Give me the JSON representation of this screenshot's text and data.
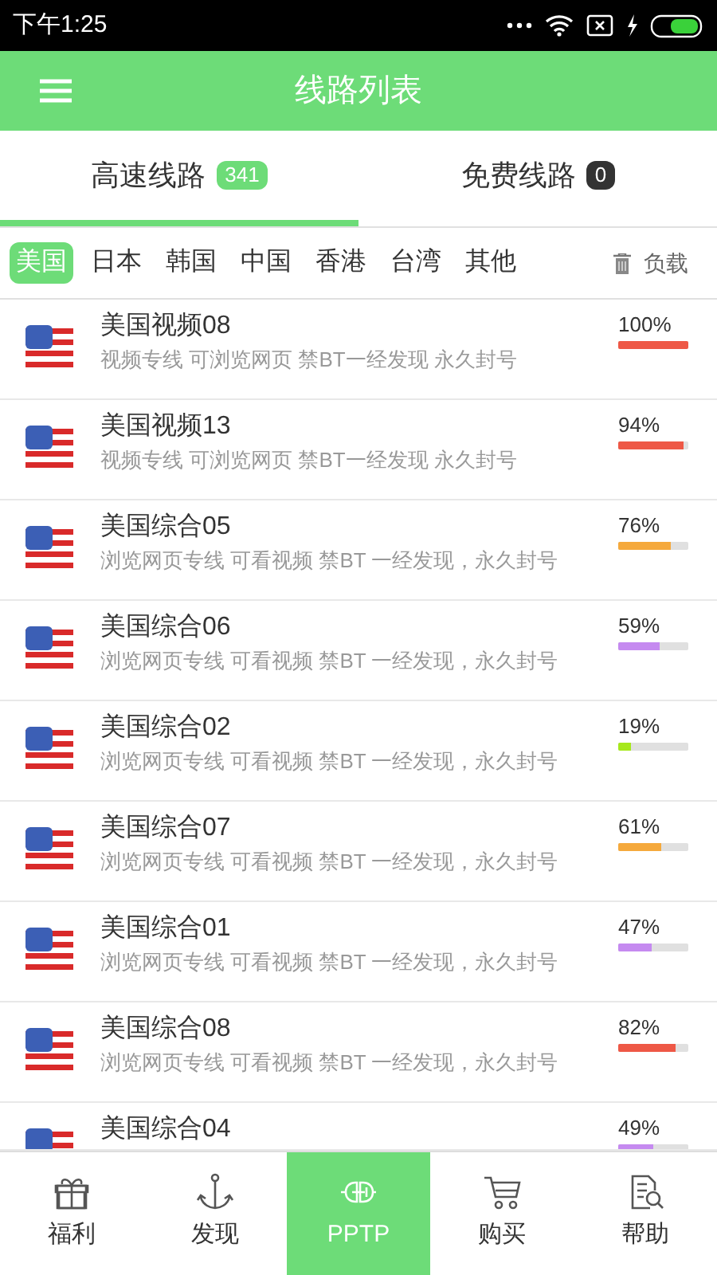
{
  "status_bar": {
    "time": "下午1:25"
  },
  "header": {
    "title": "线路列表"
  },
  "tabs": [
    {
      "label": "高速线路",
      "count": "341",
      "selected": true
    },
    {
      "label": "免费线路",
      "count": "0",
      "selected": false
    }
  ],
  "regions": [
    {
      "label": "美国",
      "selected": true
    },
    {
      "label": "日本",
      "selected": false
    },
    {
      "label": "韩国",
      "selected": false
    },
    {
      "label": "中国",
      "selected": false
    },
    {
      "label": "香港",
      "selected": false
    },
    {
      "label": "台湾",
      "selected": false
    },
    {
      "label": "其他",
      "selected": false
    }
  ],
  "load_sort": {
    "label": "负载"
  },
  "servers": [
    {
      "name": "美国视频08",
      "description": "视频专线 可浏览网页 禁BT一经发现 永久封号",
      "reading": "100%",
      "level": 1.0,
      "color": "#ee5846"
    },
    {
      "name": "美国视频13",
      "description": "视频专线 可浏览网页 禁BT一经发现 永久封号",
      "reading": "94%",
      "level": 0.94,
      "color": "#ee5846"
    },
    {
      "name": "美国综合05",
      "description": "浏览网页专线 可看视频 禁BT 一经发现，永久封号",
      "reading": "76%",
      "level": 0.76,
      "color": "#f5a93c"
    },
    {
      "name": "美国综合06",
      "description": "浏览网页专线 可看视频 禁BT 一经发现，永久封号",
      "reading": "59%",
      "level": 0.59,
      "color": "#c58af0"
    },
    {
      "name": "美国综合02",
      "description": "浏览网页专线 可看视频 禁BT 一经发现，永久封号",
      "reading": "19%",
      "level": 0.19,
      "color": "#a6e81c"
    },
    {
      "name": "美国综合07",
      "description": "浏览网页专线 可看视频 禁BT 一经发现，永久封号",
      "reading": "61%",
      "level": 0.61,
      "color": "#f5a93c"
    },
    {
      "name": "美国综合01",
      "description": "浏览网页专线 可看视频 禁BT 一经发现，永久封号",
      "reading": "47%",
      "level": 0.47,
      "color": "#c58af0"
    },
    {
      "name": "美国综合08",
      "description": "浏览网页专线 可看视频 禁BT 一经发现，永久封号",
      "reading": "82%",
      "level": 0.82,
      "color": "#ee5846"
    },
    {
      "name": "美国综合04",
      "reading": "49%",
      "level": 0.49,
      "color": "#c58af0"
    }
  ],
  "bottom_nav": [
    {
      "kind": "gift",
      "label": "福利",
      "selected": false
    },
    {
      "kind": "anchor",
      "label": "发现",
      "selected": false
    },
    {
      "kind": "plug",
      "label": "PPTP",
      "selected": true
    },
    {
      "kind": "cart",
      "label": "购买",
      "selected": false
    },
    {
      "kind": "document",
      "label": "帮助",
      "selected": false
    }
  ]
}
